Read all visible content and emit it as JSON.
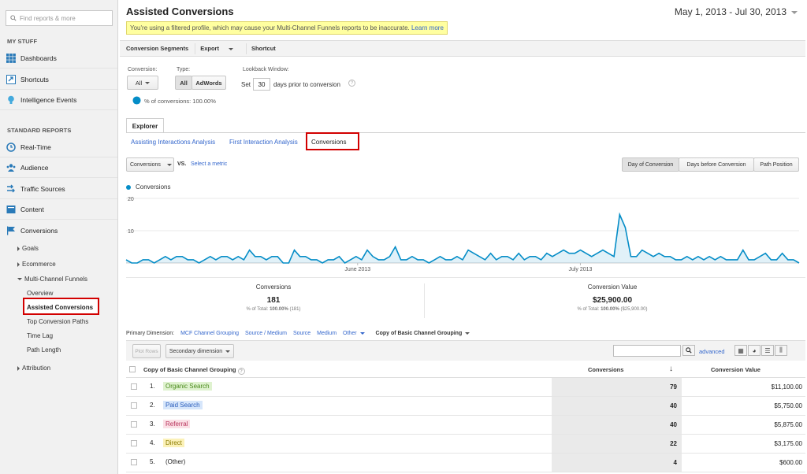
{
  "sidebar": {
    "search_placeholder": "Find reports & more",
    "my_stuff": "MY STUFF",
    "dashboards": "Dashboards",
    "shortcuts": "Shortcuts",
    "intelligence": "Intelligence Events",
    "standard_reports": "STANDARD REPORTS",
    "realtime": "Real-Time",
    "audience": "Audience",
    "traffic": "Traffic Sources",
    "content": "Content",
    "conversions": "Conversions",
    "goals": "Goals",
    "ecommerce": "Ecommerce",
    "mcf": "Multi-Channel Funnels",
    "overview": "Overview",
    "assisted": "Assisted Conversions",
    "top_paths": "Top Conversion Paths",
    "time_lag": "Time Lag",
    "path_length": "Path Length",
    "attribution": "Attribution"
  },
  "header": {
    "title": "Assisted Conversions",
    "date_range": "May 1, 2013 - Jul 30, 2013",
    "warning": "You're using a filtered profile, which may cause your Multi-Channel Funnels reports to be inaccurate.",
    "learn_more": "Learn more"
  },
  "toolbar": {
    "segments": "Conversion Segments",
    "export": "Export",
    "shortcut": "Shortcut"
  },
  "controls": {
    "conversion_label": "Conversion:",
    "conversion_value": "All",
    "type_label": "Type:",
    "type_all": "All",
    "type_adwords": "AdWords",
    "lookback_label": "Lookback Window:",
    "set": "Set",
    "days_value": "30",
    "days_prior": "days prior to conversion",
    "percent_conv": "% of conversions: 100.00%"
  },
  "tabs": {
    "explorer": "Explorer",
    "assisting": "Assisting Interactions Analysis",
    "first": "First Interaction Analysis",
    "conversions": "Conversions"
  },
  "graph_controls": {
    "metric": "Conversions",
    "vs": "VS.",
    "select_metric": "Select a metric",
    "day": "Day of Conversion",
    "days_before": "Days before Conversion",
    "path_position": "Path Position",
    "legend": "Conversions"
  },
  "chart_data": {
    "type": "line",
    "series": [
      {
        "name": "Conversions",
        "color": "#058dc7",
        "values": [
          1,
          0,
          0,
          1,
          1,
          0,
          1,
          2,
          1,
          2,
          2,
          1,
          1,
          0,
          1,
          2,
          1,
          2,
          2,
          1,
          2,
          1,
          4,
          2,
          2,
          1,
          2,
          2,
          0,
          0,
          4,
          2,
          2,
          1,
          1,
          0,
          1,
          1,
          2,
          0,
          1,
          2,
          1,
          4,
          2,
          1,
          1,
          2,
          5,
          1,
          1,
          2,
          1,
          1,
          0,
          1,
          2,
          1,
          1,
          2,
          1,
          4,
          3,
          2,
          1,
          3,
          1,
          2,
          2,
          1,
          3,
          1,
          2,
          2,
          1,
          3,
          2,
          3,
          4,
          3,
          3,
          4,
          3,
          2,
          3,
          4,
          3,
          2,
          15,
          11,
          2,
          2,
          4,
          3,
          2,
          3,
          2,
          2,
          1,
          1,
          2,
          1,
          2,
          1,
          2,
          1,
          2,
          1,
          1,
          1,
          4,
          1,
          1,
          2,
          3,
          1,
          1,
          3,
          1,
          1,
          0
        ]
      }
    ],
    "ylim": [
      0,
      20
    ],
    "yticks": [
      "20",
      "10"
    ],
    "xticks": [
      "June 2013",
      "July 2013"
    ]
  },
  "summary": {
    "conv_label": "Conversions",
    "conv_value": "181",
    "conv_sub_pre": "% of Total:",
    "conv_sub_bold": "100.00%",
    "conv_sub_post": "(181)",
    "value_label": "Conversion Value",
    "value_value": "$25,900.00",
    "value_sub_pre": "% of Total:",
    "value_sub_bold": "100.00%",
    "value_sub_post": "($25,900.00)"
  },
  "dimensions": {
    "label": "Primary Dimension:",
    "mcf": "MCF Channel Grouping",
    "source_medium": "Source / Medium",
    "source": "Source",
    "medium": "Medium",
    "other": "Other",
    "copy": "Copy of Basic Channel Grouping"
  },
  "table": {
    "plot_rows": "Plot Rows",
    "secondary": "Secondary dimension",
    "advanced": "advanced",
    "col_channel": "Copy of Basic Channel Grouping",
    "col_conv": "Conversions",
    "col_value": "Conversion Value",
    "rows": [
      {
        "n": "1.",
        "name": "Organic Search",
        "conv": "79",
        "value": "$11,100.00"
      },
      {
        "n": "2.",
        "name": "Paid Search",
        "conv": "40",
        "value": "$5,750.00"
      },
      {
        "n": "3.",
        "name": "Referral",
        "conv": "40",
        "value": "$5,875.00"
      },
      {
        "n": "4.",
        "name": "Direct",
        "conv": "22",
        "value": "$3,175.00"
      },
      {
        "n": "5.",
        "name": "(Other)",
        "conv": "4",
        "value": "$600.00"
      }
    ]
  },
  "colors": {
    "accent": "#058dc7",
    "link": "#3366cc",
    "highlight": "#d20000",
    "organic": "#dff2cf",
    "paid": "#d6e6fb",
    "referral": "#fbe0e6",
    "direct": "#fbf1b8"
  }
}
